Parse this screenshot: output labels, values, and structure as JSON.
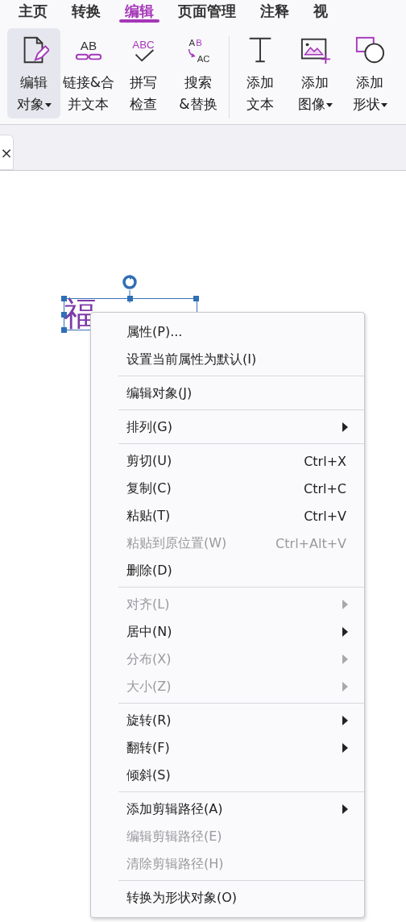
{
  "tabs": [
    {
      "label": "主页",
      "selected": false
    },
    {
      "label": "转换",
      "selected": false
    },
    {
      "label": "编辑",
      "selected": true
    },
    {
      "label": "页面管理",
      "selected": false
    },
    {
      "label": "注释",
      "selected": false
    },
    {
      "label": "视",
      "selected": false
    }
  ],
  "ribbon": [
    {
      "kind": "edit-object",
      "lines": [
        "编辑",
        "对象"
      ],
      "dropdown": true,
      "selected": true
    },
    {
      "kind": "link",
      "icon_text": [
        "AB"
      ],
      "lines": [
        "链接&合",
        "并文本"
      ],
      "dropdown": false,
      "selected": false
    },
    {
      "kind": "spell",
      "icon_text": [
        "ABC"
      ],
      "lines": [
        "拼写",
        "检查"
      ],
      "dropdown": false,
      "selected": false
    },
    {
      "kind": "replace",
      "icon_text": [
        "A",
        "B",
        "AC"
      ],
      "lines": [
        "搜索",
        "&替换"
      ],
      "dropdown": false,
      "selected": false
    },
    {
      "kind": "separator"
    },
    {
      "kind": "text",
      "lines": [
        "添加",
        "文本"
      ],
      "dropdown": false,
      "selected": false
    },
    {
      "kind": "image",
      "lines": [
        "添加",
        "图像"
      ],
      "dropdown": true,
      "selected": false
    },
    {
      "kind": "shape",
      "lines": [
        "添加",
        "形状"
      ],
      "dropdown": true,
      "selected": false
    }
  ],
  "doc_tab": {
    "close": "×"
  },
  "text_object": {
    "text": "福"
  },
  "context_menu": [
    {
      "kind": "item",
      "label": "属性(P)...",
      "disabled": false,
      "submenu": false
    },
    {
      "kind": "item",
      "label": "设置当前属性为默认(I)",
      "disabled": false,
      "submenu": false
    },
    {
      "kind": "separator"
    },
    {
      "kind": "item",
      "label": "编辑对象(J)",
      "disabled": false,
      "submenu": false
    },
    {
      "kind": "separator"
    },
    {
      "kind": "item",
      "label": "排列(G)",
      "disabled": false,
      "submenu": true
    },
    {
      "kind": "separator"
    },
    {
      "kind": "item",
      "label": "剪切(U)",
      "shortcut": "Ctrl+X",
      "disabled": false,
      "submenu": false
    },
    {
      "kind": "item",
      "label": "复制(C)",
      "shortcut": "Ctrl+C",
      "disabled": false,
      "submenu": false
    },
    {
      "kind": "item",
      "label": "粘贴(T)",
      "shortcut": "Ctrl+V",
      "disabled": false,
      "submenu": false
    },
    {
      "kind": "item",
      "label": "粘贴到原位置(W)",
      "shortcut": "Ctrl+Alt+V",
      "disabled": true,
      "submenu": false
    },
    {
      "kind": "item",
      "label": "删除(D)",
      "disabled": false,
      "submenu": false
    },
    {
      "kind": "separator"
    },
    {
      "kind": "item",
      "label": "对齐(L)",
      "disabled": true,
      "submenu": true
    },
    {
      "kind": "item",
      "label": "居中(N)",
      "disabled": false,
      "submenu": true
    },
    {
      "kind": "item",
      "label": "分布(X)",
      "disabled": true,
      "submenu": true
    },
    {
      "kind": "item",
      "label": "大小(Z)",
      "disabled": true,
      "submenu": true
    },
    {
      "kind": "separator"
    },
    {
      "kind": "item",
      "label": "旋转(R)",
      "disabled": false,
      "submenu": true
    },
    {
      "kind": "item",
      "label": "翻转(F)",
      "disabled": false,
      "submenu": true
    },
    {
      "kind": "item",
      "label": "倾斜(S)",
      "disabled": false,
      "submenu": false
    },
    {
      "kind": "separator"
    },
    {
      "kind": "item",
      "label": "添加剪辑路径(A)",
      "disabled": false,
      "submenu": true
    },
    {
      "kind": "item",
      "label": "编辑剪辑路径(E)",
      "disabled": true,
      "submenu": false
    },
    {
      "kind": "item",
      "label": "清除剪辑路径(H)",
      "disabled": true,
      "submenu": false
    },
    {
      "kind": "separator"
    },
    {
      "kind": "item",
      "label": "转换为形状对象(O)",
      "disabled": false,
      "submenu": false
    }
  ]
}
